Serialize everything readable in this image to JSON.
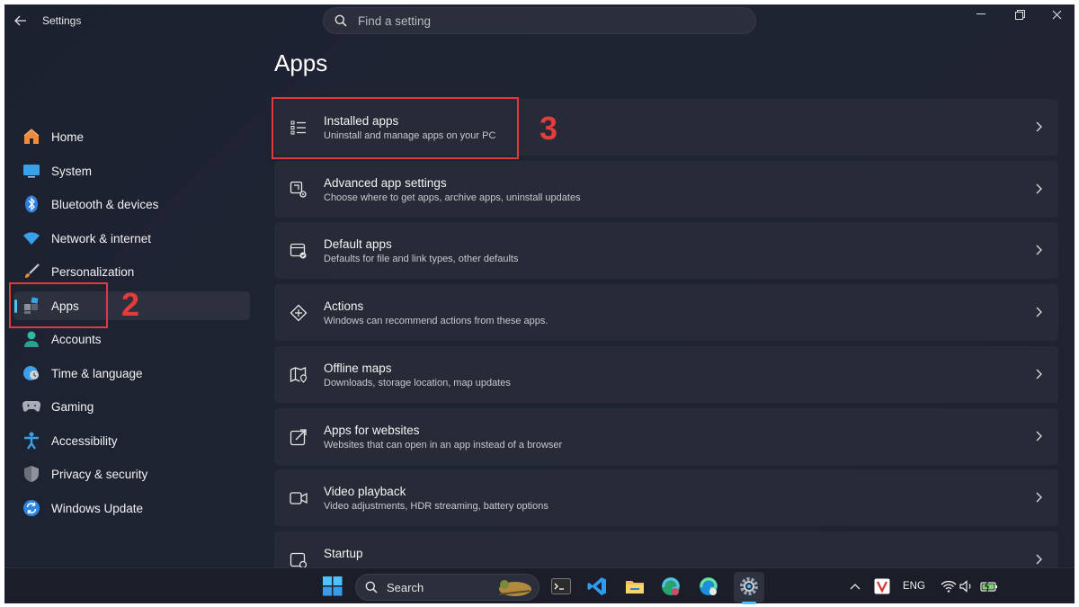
{
  "window": {
    "title": "Settings",
    "search_placeholder": "Find a setting"
  },
  "sidebar": {
    "items": [
      {
        "label": "Home",
        "icon": "home-icon"
      },
      {
        "label": "System",
        "icon": "system-icon"
      },
      {
        "label": "Bluetooth & devices",
        "icon": "bluetooth-icon"
      },
      {
        "label": "Network & internet",
        "icon": "wifi-icon"
      },
      {
        "label": "Personalization",
        "icon": "brush-icon"
      },
      {
        "label": "Apps",
        "icon": "apps-icon",
        "selected": true
      },
      {
        "label": "Accounts",
        "icon": "accounts-icon"
      },
      {
        "label": "Time & language",
        "icon": "clock-globe-icon"
      },
      {
        "label": "Gaming",
        "icon": "gamepad-icon"
      },
      {
        "label": "Accessibility",
        "icon": "accessibility-icon"
      },
      {
        "label": "Privacy & security",
        "icon": "shield-icon"
      },
      {
        "label": "Windows Update",
        "icon": "update-icon"
      }
    ]
  },
  "main": {
    "title": "Apps",
    "cards": [
      {
        "title": "Installed apps",
        "subtitle": "Uninstall and manage apps on your PC",
        "icon": "list-icon"
      },
      {
        "title": "Advanced app settings",
        "subtitle": "Choose where to get apps, archive apps, uninstall updates",
        "icon": "app-settings-icon"
      },
      {
        "title": "Default apps",
        "subtitle": "Defaults for file and link types, other defaults",
        "icon": "default-apps-icon"
      },
      {
        "title": "Actions",
        "subtitle": "Windows can recommend actions from these apps.",
        "icon": "actions-icon"
      },
      {
        "title": "Offline maps",
        "subtitle": "Downloads, storage location, map updates",
        "icon": "map-icon"
      },
      {
        "title": "Apps for websites",
        "subtitle": "Websites that can open in an app instead of a browser",
        "icon": "open-external-icon"
      },
      {
        "title": "Video playback",
        "subtitle": "Video adjustments, HDR streaming, battery options",
        "icon": "video-icon"
      },
      {
        "title": "Startup",
        "subtitle": "",
        "icon": "startup-icon"
      }
    ]
  },
  "annotations": {
    "step2": "2",
    "step3": "3",
    "color": "#e03a3a"
  },
  "taskbar": {
    "search_label": "Search",
    "language": "ENG"
  },
  "colors": {
    "accent": "#4cc2ff",
    "background": "#1f2433",
    "card": "#272b37"
  }
}
